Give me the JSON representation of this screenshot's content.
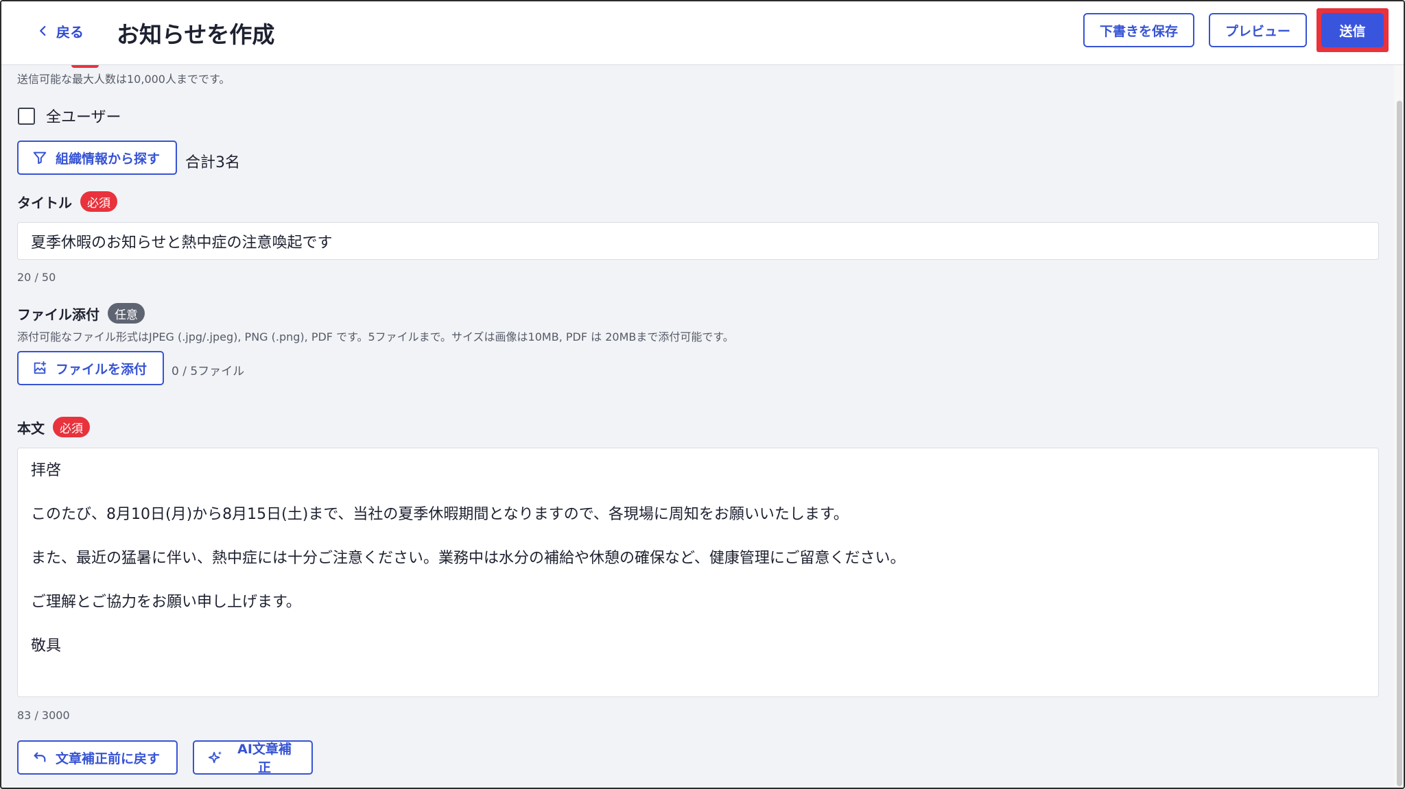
{
  "header": {
    "back_label": "戻る",
    "title": "お知らせを作成",
    "save_draft_label": "下書きを保存",
    "preview_label": "プレビュー",
    "send_label": "送信"
  },
  "recipients": {
    "max_hint": "送信可能な最大人数は10,000人までです。",
    "all_users_label": "全ユーザー",
    "all_users_checked": false,
    "search_org_label": "組織情報から探す",
    "total": "合計3名"
  },
  "title_field": {
    "label": "タイトル",
    "badge": "必須",
    "value": "夏季休暇のお知らせと熱中症の注意喚起です",
    "counter": "20 / 50"
  },
  "attachment": {
    "label": "ファイル添付",
    "badge": "任意",
    "hint": "添付可能なファイル形式はJPEG (.jpg/.jpeg), PNG (.png), PDF です。5ファイルまで。サイズは画像は10MB, PDF は 20MBまで添付可能です。",
    "button_label": "ファイルを添付",
    "count": "0 / 5ファイル"
  },
  "body_field": {
    "label": "本文",
    "badge": "必須",
    "paragraphs": [
      "拝啓",
      "このたび、8月10日(月)から8月15日(土)まで、当社の夏季休暇期間となりますので、各現場に周知をお願いいたします。",
      "また、最近の猛暑に伴い、熱中症には十分ご注意ください。業務中は水分の補給や休憩の確保など、健康管理にご留意ください。",
      "ご理解とご協力をお願い申し上げます。",
      "敬具"
    ],
    "counter": "83 / 3000",
    "revert_label": "文章補正前に戻す",
    "ai_label": "AI文章補正"
  },
  "colors": {
    "accent": "#3653d4",
    "required": "#e8323c",
    "optional": "#5f6472",
    "send_highlight": "#e8323c"
  }
}
